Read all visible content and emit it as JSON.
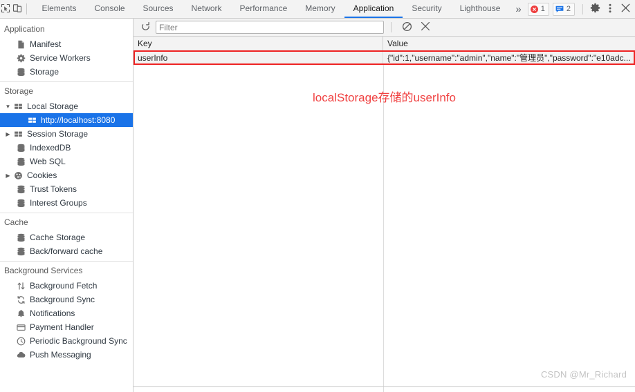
{
  "toolbar": {
    "inspect_icon": "inspect-cursor-icon",
    "device_icon": "device-toolbar-icon",
    "tabs": [
      {
        "label": "Elements",
        "active": false
      },
      {
        "label": "Console",
        "active": false
      },
      {
        "label": "Sources",
        "active": false
      },
      {
        "label": "Network",
        "active": false
      },
      {
        "label": "Performance",
        "active": false
      },
      {
        "label": "Memory",
        "active": false
      },
      {
        "label": "Application",
        "active": true
      },
      {
        "label": "Security",
        "active": false
      },
      {
        "label": "Lighthouse",
        "active": false
      }
    ],
    "overflow_label": "»",
    "error_count": "1",
    "message_count": "2",
    "settings_icon": "gear-icon",
    "more_icon": "kebab-menu-icon",
    "close_icon": "close-icon",
    "active_tab_color": "#1a73e8",
    "error_color": "#ee3e3e",
    "message_color": "#1a73e8"
  },
  "sidebar": {
    "sections": [
      {
        "title": "Application",
        "items": [
          {
            "label": "Manifest",
            "icon": "manifest-document-icon",
            "indent": 1,
            "twisty": "none",
            "selected": false
          },
          {
            "label": "Service Workers",
            "icon": "gear-icon",
            "indent": 1,
            "twisty": "none",
            "selected": false
          },
          {
            "label": "Storage",
            "icon": "database-icon",
            "indent": 1,
            "twisty": "none",
            "selected": false
          }
        ]
      },
      {
        "title": "Storage",
        "items": [
          {
            "label": "Local Storage",
            "icon": "table-grid-icon",
            "indent": 0,
            "twisty": "expanded",
            "selected": false
          },
          {
            "label": "http://localhost:8080",
            "icon": "table-grid-icon",
            "indent": 2,
            "twisty": "none",
            "selected": true
          },
          {
            "label": "Session Storage",
            "icon": "table-grid-icon",
            "indent": 0,
            "twisty": "collapsed",
            "selected": false
          },
          {
            "label": "IndexedDB",
            "icon": "database-icon",
            "indent": 1,
            "twisty": "none",
            "selected": false
          },
          {
            "label": "Web SQL",
            "icon": "database-icon",
            "indent": 1,
            "twisty": "none",
            "selected": false
          },
          {
            "label": "Cookies",
            "icon": "cookie-icon",
            "indent": 0,
            "twisty": "collapsed",
            "selected": false
          },
          {
            "label": "Trust Tokens",
            "icon": "database-icon",
            "indent": 1,
            "twisty": "none",
            "selected": false
          },
          {
            "label": "Interest Groups",
            "icon": "database-icon",
            "indent": 1,
            "twisty": "none",
            "selected": false
          }
        ]
      },
      {
        "title": "Cache",
        "items": [
          {
            "label": "Cache Storage",
            "icon": "database-icon",
            "indent": 1,
            "twisty": "none",
            "selected": false
          },
          {
            "label": "Back/forward cache",
            "icon": "database-icon",
            "indent": 1,
            "twisty": "none",
            "selected": false
          }
        ]
      },
      {
        "title": "Background Services",
        "items": [
          {
            "label": "Background Fetch",
            "icon": "up-down-arrows-icon",
            "indent": 1,
            "twisty": "none",
            "selected": false
          },
          {
            "label": "Background Sync",
            "icon": "sync-icon",
            "indent": 1,
            "twisty": "none",
            "selected": false
          },
          {
            "label": "Notifications",
            "icon": "bell-icon",
            "indent": 1,
            "twisty": "none",
            "selected": false
          },
          {
            "label": "Payment Handler",
            "icon": "credit-card-icon",
            "indent": 1,
            "twisty": "none",
            "selected": false
          },
          {
            "label": "Periodic Background Sync",
            "icon": "clock-icon",
            "indent": 1,
            "twisty": "none",
            "selected": false
          },
          {
            "label": "Push Messaging",
            "icon": "cloud-icon",
            "indent": 1,
            "twisty": "none",
            "selected": false
          }
        ]
      }
    ],
    "selected_color": "#1a73e8"
  },
  "storage_toolbar": {
    "refresh_icon": "refresh-icon",
    "filter_placeholder": "Filter",
    "filter_value": "",
    "clear_all_icon": "clear-all-icon",
    "delete_selected_icon": "delete-selected-icon"
  },
  "table": {
    "columns": [
      "Key",
      "Value"
    ],
    "rows": [
      {
        "key": "userInfo",
        "value": "{\"id\":1,\"username\":\"admin\",\"name\":\"管理员\",\"password\":\"e10adc..."
      }
    ]
  },
  "annotation": {
    "text": "localStorage存储的userInfo",
    "color": "#f04242"
  },
  "watermark": {
    "text": "CSDN @Mr_Richard"
  }
}
